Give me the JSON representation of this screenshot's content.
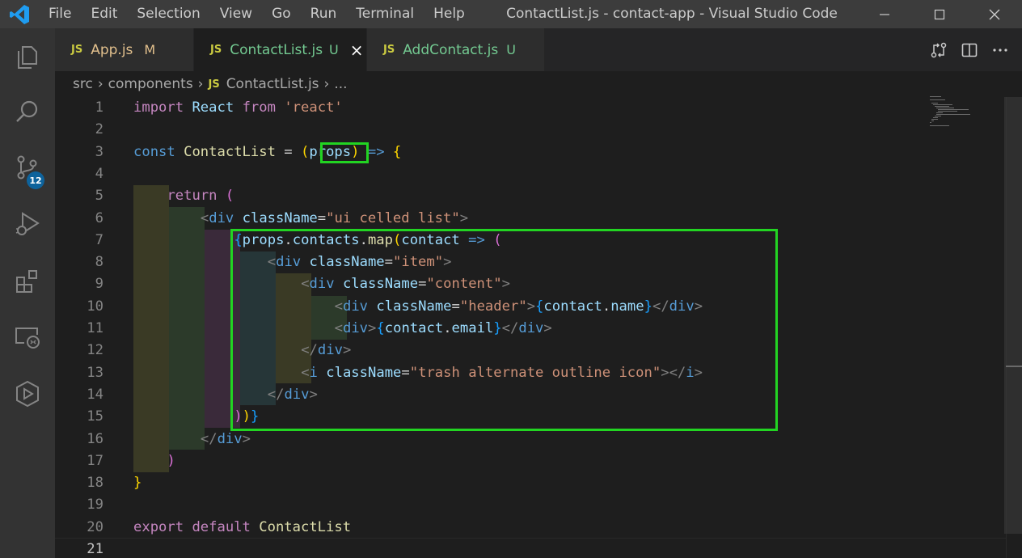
{
  "titlebar": {
    "menu": [
      "File",
      "Edit",
      "Selection",
      "View",
      "Go",
      "Run",
      "Terminal",
      "Help"
    ],
    "title": "ContactList.js - contact-app - Visual Studio Code"
  },
  "activity_bar": {
    "source_control_badge": "12"
  },
  "tabs": [
    {
      "icon": "JS",
      "label": "App.js",
      "decoration": "M"
    },
    {
      "icon": "JS",
      "label": "ContactList.js",
      "decoration": "U"
    },
    {
      "icon": "JS",
      "label": "AddContact.js",
      "decoration": "U"
    }
  ],
  "breadcrumb": {
    "items": [
      "src",
      "components",
      "ContactList.js",
      "..."
    ],
    "file_icon": "JS"
  },
  "editor": {
    "line_numbers": [
      "1",
      "2",
      "3",
      "4",
      "5",
      "6",
      "7",
      "8",
      "9",
      "10",
      "11",
      "12",
      "13",
      "14",
      "15",
      "16",
      "17",
      "18",
      "19",
      "20",
      "21"
    ],
    "lines": [
      "import React from 'react'",
      "",
      "const ContactList = (props) => {",
      "",
      "    return (",
      "        <div className=\"ui celled list\">",
      "            {props.contacts.map(contact => (",
      "                <div className=\"item\">",
      "                    <div className=\"content\">",
      "                        <div className=\"header\">{contact.name}</div>",
      "                        <div>{contact.email}</div>",
      "                    </div>",
      "                    <i className=\"trash alternate outline icon\"></i>",
      "                </div>",
      "            ))}",
      "        </div>",
      "    )",
      "}",
      "",
      "export default ContactList",
      ""
    ]
  },
  "colors": {
    "highlight_box": "#22d422",
    "titlebar_bg": "#3c3c3c",
    "activitybar_bg": "#333333",
    "editor_bg": "#1e1e1e",
    "badge_bg": "#0e639c"
  }
}
